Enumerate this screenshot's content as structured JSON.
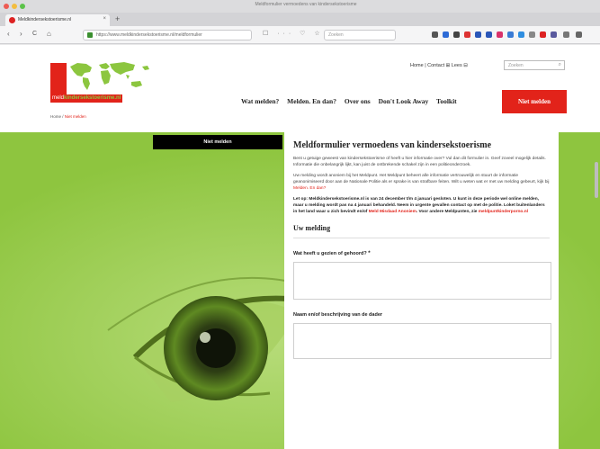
{
  "window": {
    "title": "Meldformulier vermoedens van kindersekstoerisme"
  },
  "tab": {
    "title": "Meldkindersekstoerisme.nl",
    "close": "×",
    "new": "+"
  },
  "nav": {
    "back": "‹",
    "forward": "›",
    "reload": "C",
    "home": "⌂",
    "url": "https://www.meldkindersekstoerisme.nl/meldformulier",
    "page_actions": "☐ ··· ♡ ☆",
    "search_placeholder": "Zoeken"
  },
  "site": {
    "util_nav": "Home | Contact  ⊞ Lees ⊟",
    "search_placeholder": "Zoeken",
    "search_icon": "⌕",
    "logo_text_a": "meld",
    "logo_text_b": "kindersekstoerisme.nl",
    "breadcrumb_home": "Home",
    "breadcrumb_sep": " / ",
    "breadcrumb_current": "Niet melden",
    "menu": [
      "Wat melden?",
      "Melden. En dan?",
      "Over ons",
      "Don't Look Away",
      "Toolkit"
    ],
    "cta": "Niet melden",
    "side_button": "Niet melden"
  },
  "form": {
    "heading": "Meldformulier vermoedens van kindersekstoerisme",
    "intro1": "Bent u getuige geweest van kindersekstoerisme of heeft u hier informatie over? Vul dan dit formulier in. Geef zoveel mogelijk details. Informatie die onbelangrijk lijkt, kan juist de ontbrekende schakel zijn in een politieonderzoek.",
    "intro2": "Uw melding wordt anoniem bij het Meldpunt. Het Meldpunt beheert alle informatie vertrouwelijk en stuurt de informatie geanonimiseerd door aan de Nationale Politie als er sprake is van strafbare feiten. Wilt u weten wat er met uw melding gebeurt, kijk bij ",
    "intro2_link": "Melden. En dan?",
    "notice_a": "Let op: Meldkindersekstoerisme.nl is van 24 december t/m 4 januari gesloten. U kunt in deze periode wel online melden, maar u melding wordt pas na 4 januari behandeld. Neem in urgente gevallen contact op met de politie. Loket buitenlanders in het land waar u zich bevindt en/of ",
    "notice_link1": "Meld Misdaad Anoniem",
    "notice_b": ". Voor andere Meldpunten, zie ",
    "notice_link2": "meldpuntkinderporno.nl",
    "section": "Uw melding",
    "q1": "Wat heeft u gezien of gehoord?",
    "q1_required": "*",
    "q2": "Naam en/of beschrijving van de dader"
  }
}
